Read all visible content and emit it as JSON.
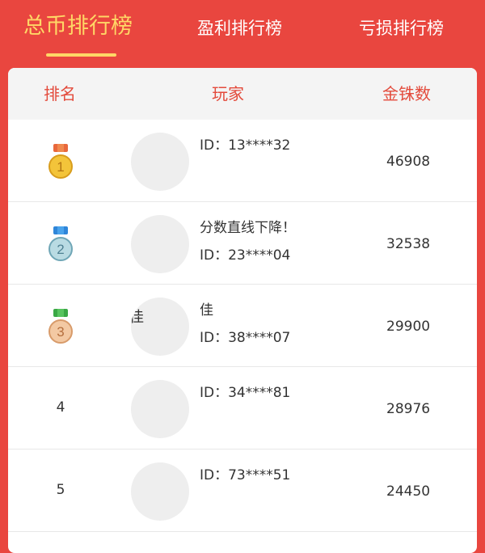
{
  "tabs": [
    {
      "label": "总币排行榜",
      "active": true
    },
    {
      "label": "盈利排行榜",
      "active": false
    },
    {
      "label": "亏损排行榜",
      "active": false
    }
  ],
  "table": {
    "headers": {
      "rank": "排名",
      "player": "玩家",
      "coins": "金铢数"
    },
    "rows": [
      {
        "rank": "1",
        "medal_icon": "gold-medal-icon",
        "nickname": "",
        "player_id": "ID：13****32",
        "coins": "46908"
      },
      {
        "rank": "2",
        "medal_icon": "silver-medal-icon",
        "nickname": "分数直线下降！",
        "player_id": "ID：23****04",
        "coins": "32538"
      },
      {
        "rank": "3",
        "medal_icon": "bronze-medal-icon",
        "nickname": "佳",
        "avatar_text": "佳",
        "player_id": "ID：38****07",
        "coins": "29900"
      },
      {
        "rank": "4",
        "nickname": "",
        "player_id": "ID：34****81",
        "coins": "28976"
      },
      {
        "rank": "5",
        "nickname": "",
        "player_id": "ID：73****51",
        "coins": "24450"
      }
    ]
  },
  "colors": {
    "background": "#e9463f",
    "active_tab": "#ffd766",
    "header_text": "#e34a3b",
    "gold": "#f3c43a",
    "silver": "#b9dbe3",
    "bronze": "#f3c9a3"
  }
}
